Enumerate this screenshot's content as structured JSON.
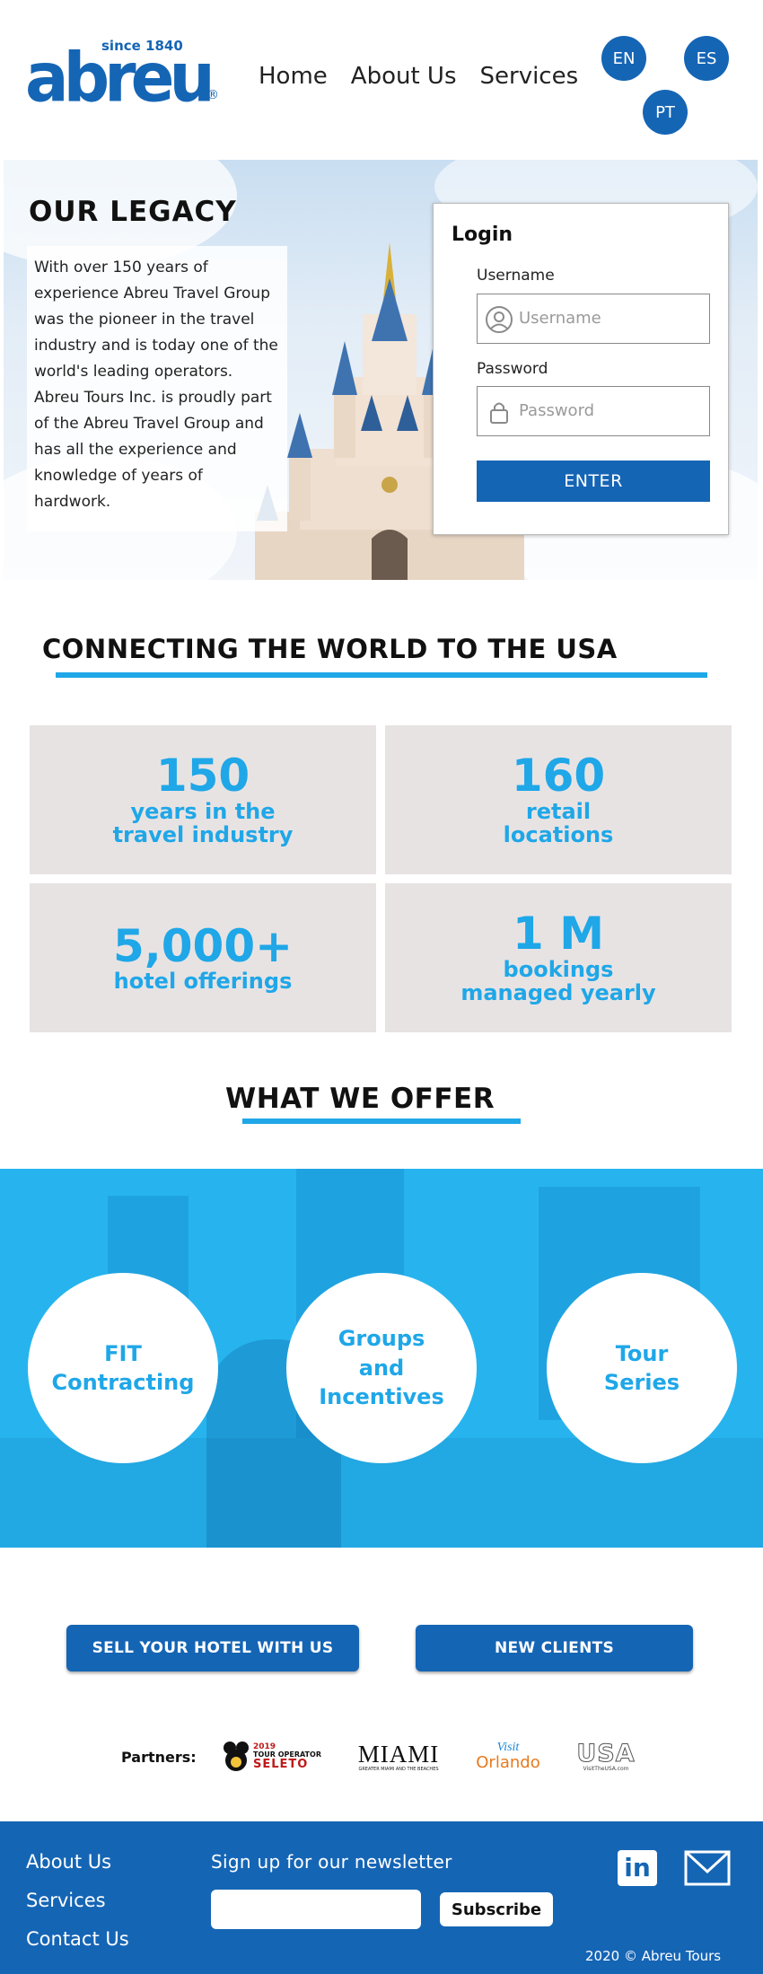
{
  "header": {
    "logo_text": "abreu",
    "logo_since": "since 1840",
    "logo_reg": "®",
    "nav": [
      "Home",
      "About Us",
      "Services"
    ],
    "languages": [
      "EN",
      "ES",
      "PT"
    ]
  },
  "hero": {
    "title": "OUR LEGACY",
    "body": "With over 150 years of experience Abreu Travel Group was the pioneer in the travel industry and is today one of the world's leading operators. Abreu Tours Inc. is proudly part of the Abreu Travel Group and has all the experience and knowledge of years of hardwork."
  },
  "login": {
    "title": "Login",
    "username_label": "Username",
    "username_placeholder": "Username",
    "password_label": "Password",
    "password_placeholder": "Password",
    "enter_label": "ENTER"
  },
  "connecting": {
    "title": "CONNECTING THE WORLD TO THE USA",
    "stats": [
      {
        "number": "150",
        "label_line1": "years in the",
        "label_line2": "travel industry"
      },
      {
        "number": "160",
        "label_line1": "retail",
        "label_line2": "locations"
      },
      {
        "number": "5,000+",
        "label_line1": "hotel offerings",
        "label_line2": ""
      },
      {
        "number": "1 M",
        "label_line1": "bookings",
        "label_line2": "managed yearly"
      }
    ]
  },
  "offer": {
    "title": "WHAT WE OFFER",
    "items": [
      {
        "line1": "FIT",
        "line2": "Contracting",
        "line3": ""
      },
      {
        "line1": "Groups",
        "line2": "and",
        "line3": "Incentives"
      },
      {
        "line1": "Tour",
        "line2": "Series",
        "line3": ""
      }
    ]
  },
  "cta": {
    "sell_hotel": "SELL YOUR HOTEL WITH US",
    "new_clients": "NEW CLIENTS"
  },
  "partners": {
    "label": "Partners:",
    "logos": [
      {
        "line1": "2019",
        "line2": "TOUR OPERATOR",
        "line3": "SELETO"
      },
      {
        "line1": "MIAMI",
        "line2": "GREATER MIAMI AND THE BEACHES"
      },
      {
        "line1": "Visit",
        "line2": "Orlando"
      },
      {
        "line1": "USA",
        "line2": "VisitTheUSA.com"
      }
    ]
  },
  "footer": {
    "links": [
      "About Us",
      "Services",
      "Contact Us"
    ],
    "newsletter_label": "Sign up for our newsletter",
    "subscribe_label": "Subscribe",
    "copyright": "2020 © Abreu Tours",
    "linkedin": "in"
  },
  "colors": {
    "brand_blue": "#1565b5",
    "accent_cyan": "#1fa7e8",
    "stat_bg": "#e8e3e3"
  }
}
